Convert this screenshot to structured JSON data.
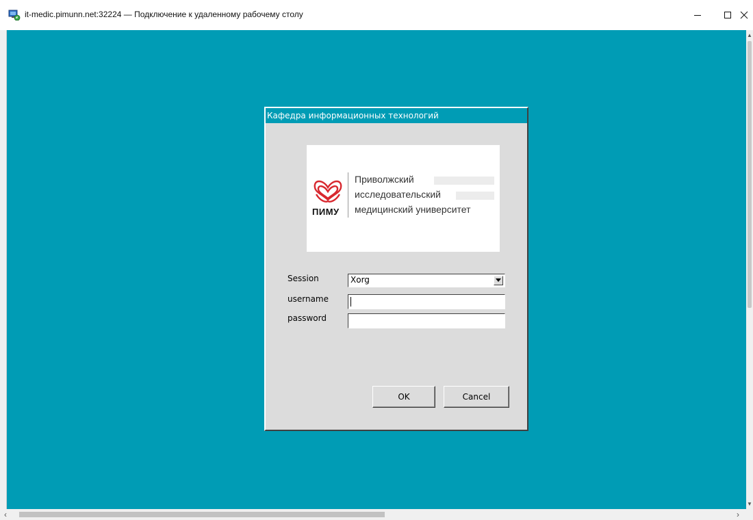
{
  "window": {
    "title": "it-medic.pimunn.net:32224 — Подключение к удаленному рабочему столу",
    "icon": "remote-desktop-icon",
    "controls": {
      "minimize": "minimize-icon",
      "maximize": "maximize-icon",
      "close": "close-icon"
    }
  },
  "colors": {
    "desktop_background": "#009cb5",
    "dialog_background": "#dcdcdc",
    "dialog_title_background": "#009cb5",
    "logo_red": "#d8282f"
  },
  "dialog": {
    "title": "Кафедра информационных технологий",
    "logo": {
      "abbreviation": "ПИМУ",
      "line1": "Приволжский",
      "line2": "исследовательский",
      "line3": "медицинский университет"
    },
    "session": {
      "label": "Session",
      "value": "Xorg"
    },
    "username": {
      "label": "username",
      "value": ""
    },
    "password": {
      "label": "password",
      "value": ""
    },
    "ok_label": "OK",
    "cancel_label": "Cancel"
  },
  "scrollbars": {
    "horizontal_left": "‹",
    "horizontal_right": "›",
    "vertical_up": "▲",
    "vertical_down": "▼"
  }
}
